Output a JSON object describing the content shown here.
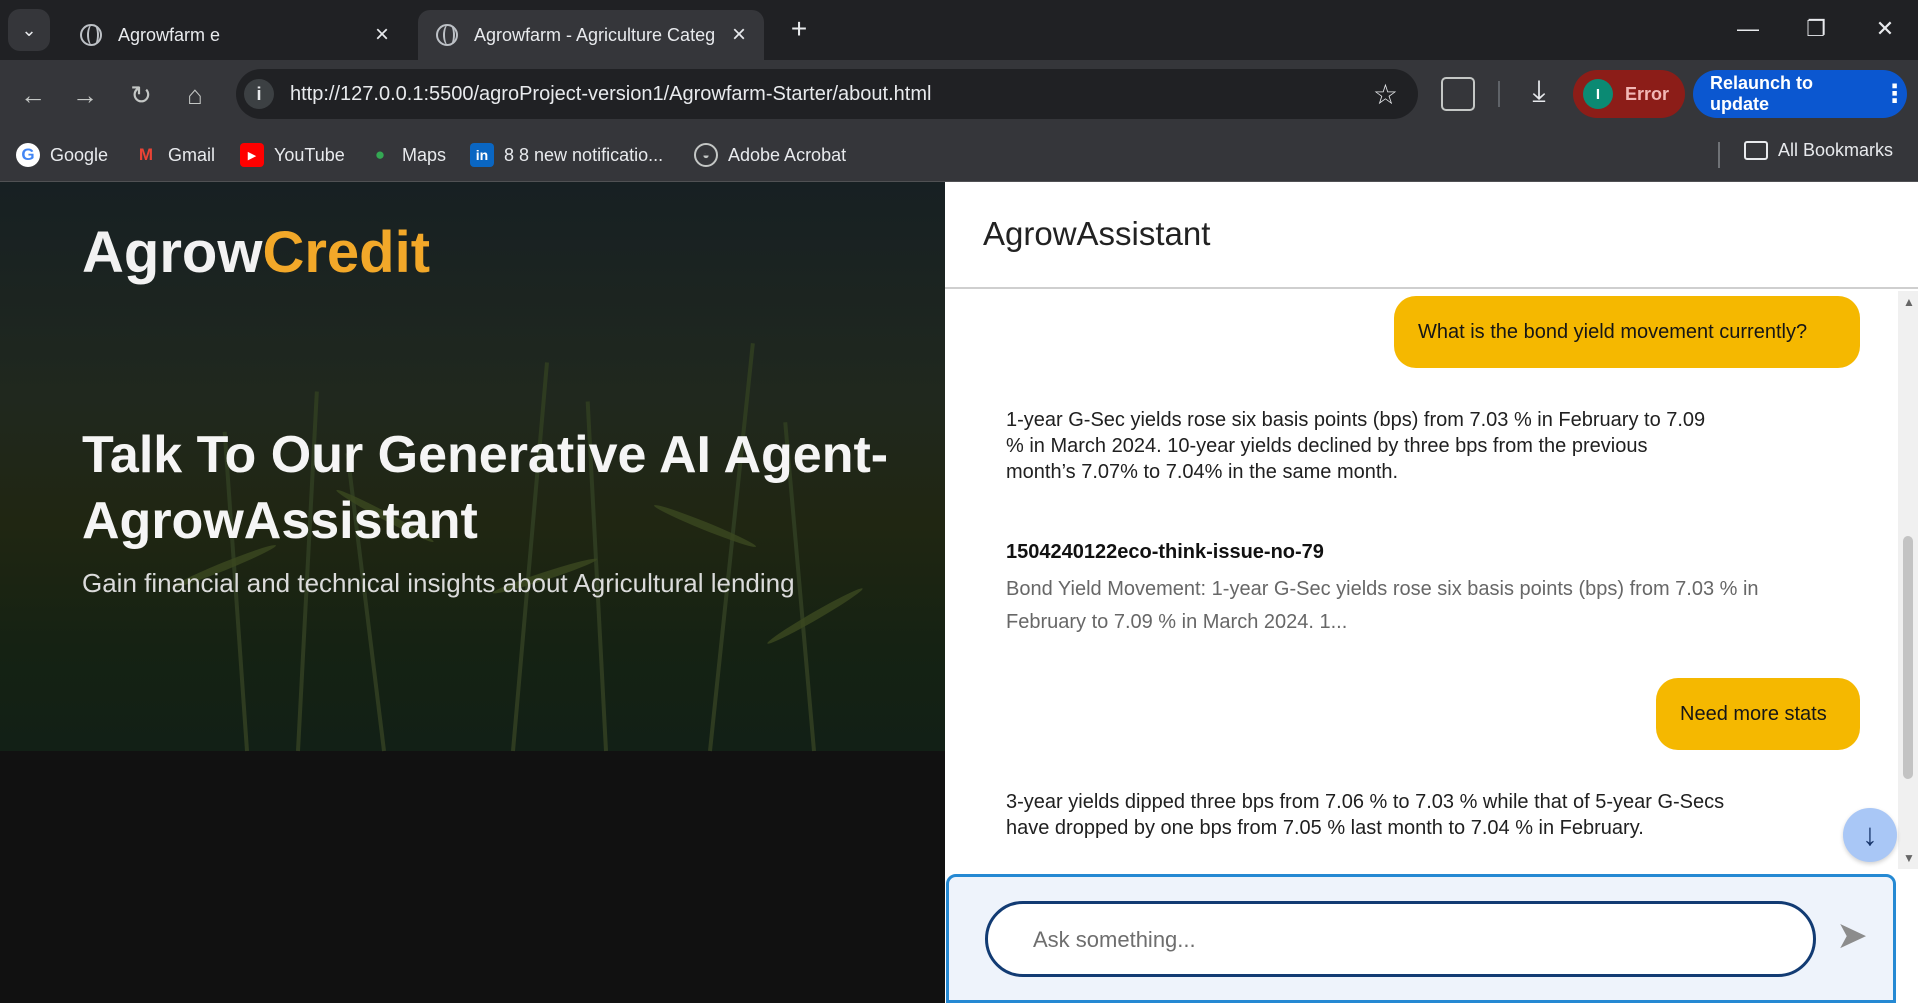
{
  "browser": {
    "tabs": [
      {
        "label": "Agrowfarm e"
      },
      {
        "label": "Agrowfarm - Agriculture Categ"
      }
    ],
    "url": "http://127.0.0.1:5500/agroProject-version1/Agrowfarm-Starter/about.html",
    "error_label": "Error",
    "profile_initial": "I",
    "relaunch_label": "Relaunch to update",
    "bookmarks": [
      {
        "label": "Google",
        "icon": "google-icon"
      },
      {
        "label": "Gmail",
        "icon": "gmail-icon"
      },
      {
        "label": "YouTube",
        "icon": "youtube-icon"
      },
      {
        "label": "Maps",
        "icon": "maps-icon"
      },
      {
        "label": "8 8 new notificatio...",
        "icon": "linkedin-icon"
      },
      {
        "label": "Adobe Acrobat",
        "icon": "adobe-acrobat-icon"
      }
    ],
    "all_bookmarks_label": "All Bookmarks"
  },
  "hero": {
    "logo_primary": "Agrow",
    "logo_accent": "Credit",
    "title": "Talk To Our Generative AI Agent- AgrowAssistant",
    "subtitle": "Gain financial and technical insights about Agricultural lending"
  },
  "chat": {
    "title": "AgrowAssistant",
    "messages": [
      {
        "role": "user",
        "text": "What is the bond yield movement currently?"
      },
      {
        "role": "assistant",
        "text": "1-year G-Sec yields rose six basis points (bps) from 7.03 % in February to 7.09 % in March 2024. 10-year yields declined by three bps from the previous month’s 7.07% to 7.04% in the same month."
      },
      {
        "role": "source",
        "title": "1504240122eco-think-issue-no-79",
        "text": "Bond Yield Movement: 1-year G-Sec yields rose six basis points (bps) from 7.03 % in February to 7.09 % in March 2024. 1..."
      },
      {
        "role": "user",
        "text": "Need more stats"
      },
      {
        "role": "assistant",
        "text": "3-year yields dipped three bps from 7.06 % to 7.03 % while that of 5-year G-Secs have dropped by one bps from 7.05 % last month to 7.04 % in February."
      }
    ],
    "input_placeholder": "Ask something..."
  },
  "colors": {
    "accent": "#f2a829",
    "user_bubble": "#f5b800",
    "input_border": "#123b73"
  }
}
